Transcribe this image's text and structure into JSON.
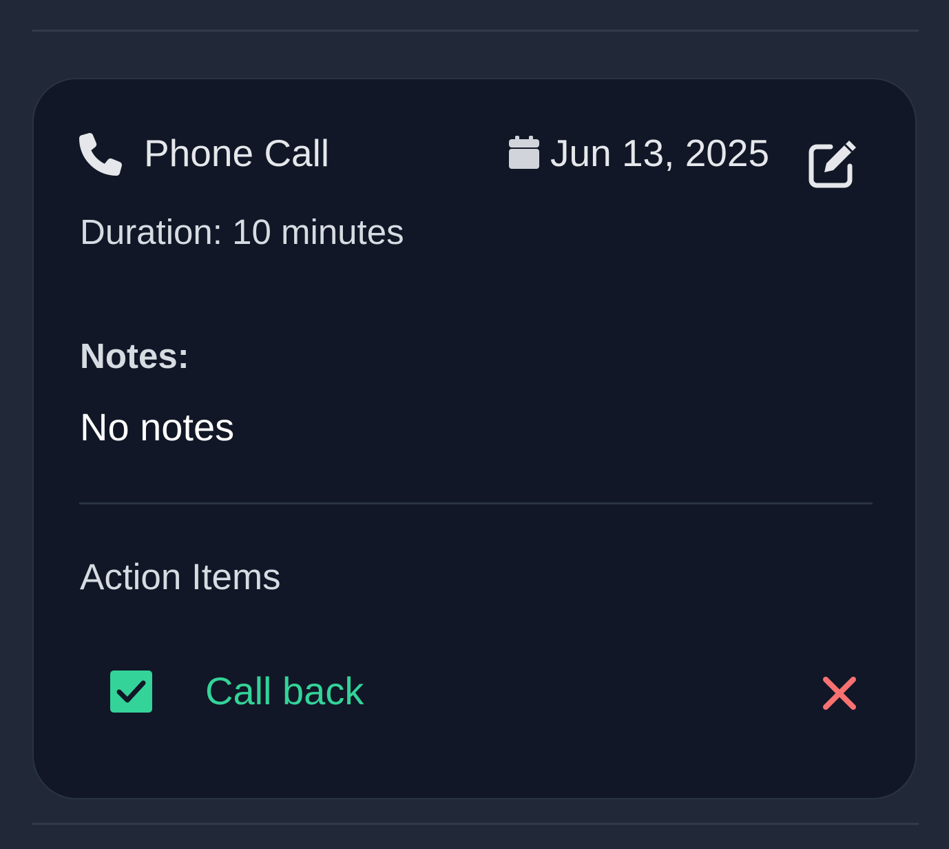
{
  "interaction": {
    "type_label": "Phone Call",
    "type_icon": "phone-icon",
    "date": "Jun 13, 2025",
    "date_icon": "calendar-icon",
    "edit_icon": "edit-icon",
    "duration": "Duration: 10 minutes",
    "notes_label": "Notes:",
    "notes_text": "No notes"
  },
  "action_items": {
    "title": "Action Items",
    "items": [
      {
        "label": "Call back",
        "completed": true,
        "delete_icon": "close-icon"
      }
    ]
  },
  "colors": {
    "page_background": "#212938",
    "card_background": "#111726",
    "text_primary": "#e5e7eb",
    "completed_green": "#34d399",
    "delete_red": "#f87171"
  }
}
